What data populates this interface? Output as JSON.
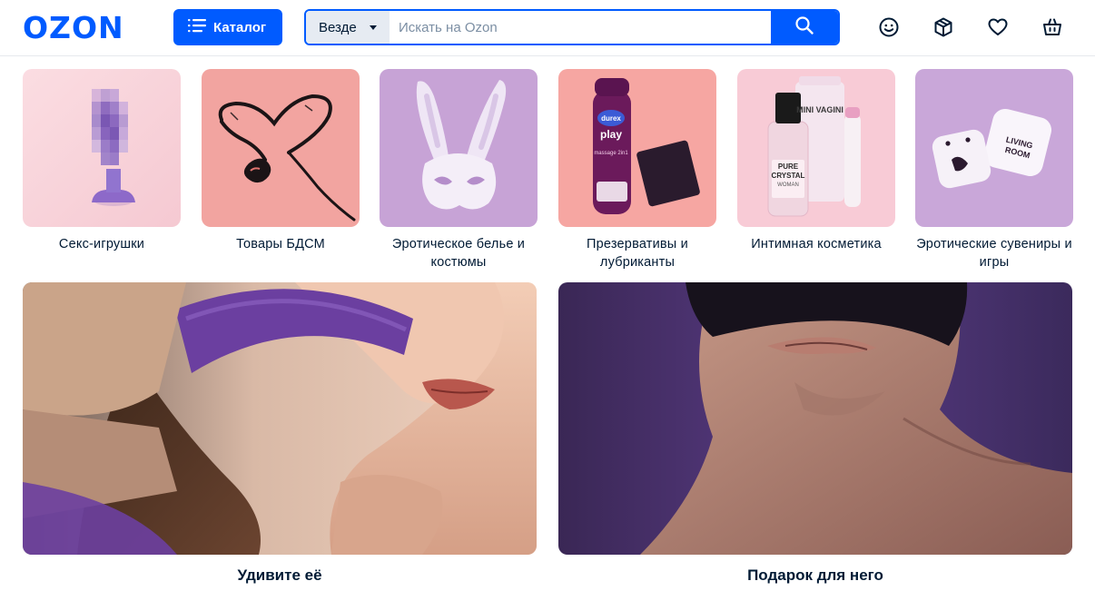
{
  "header": {
    "logo": "OZON",
    "catalog_label": "Каталог",
    "search_scope": "Везде",
    "search_placeholder": "Искать на Ozon",
    "icons": [
      "face-icon",
      "orders-box-icon",
      "heart-icon",
      "cart-bag-icon"
    ]
  },
  "colors": {
    "brand": "#005bff",
    "text": "#001a34",
    "scope_bg": "#e6ebf2"
  },
  "categories": [
    {
      "label": "Секс-игрушки"
    },
    {
      "label": "Товары БДСМ"
    },
    {
      "label": "Эротическое белье и костюмы"
    },
    {
      "label": "Презервативы и лубриканты"
    },
    {
      "label": "Интимная косметика"
    },
    {
      "label": "Эротические сувениры и игры"
    }
  ],
  "product_text": {
    "condom_brand": "durex",
    "condom_line": "play",
    "condom_sub": "massage 2in1",
    "cosmetic_tube": "MINI VAGINI",
    "cosmetic_spray_1": "PURE",
    "cosmetic_spray_2": "CRYSTAL",
    "cosmetic_spray_3": "WOMAN",
    "dice_label_1": "LIVING",
    "dice_label_2": "ROOM"
  },
  "banners": [
    {
      "label": "Удивите её"
    },
    {
      "label": "Подарок для него"
    }
  ]
}
